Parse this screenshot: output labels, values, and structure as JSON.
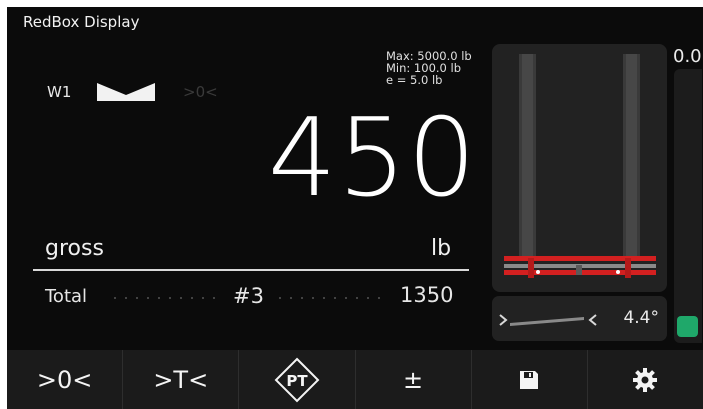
{
  "app": {
    "title": "RedBox Display"
  },
  "scale": {
    "channel": "W1",
    "zero_indicator": ">0<",
    "limits": {
      "max": "Max: 5000.0 lb",
      "min": "Min: 100.0 lb",
      "e": "e =  5.0  lb"
    },
    "weight": "450",
    "mode": "gross",
    "unit": "lb"
  },
  "total": {
    "label": "Total",
    "count": "#3",
    "value": "1350"
  },
  "tilt": {
    "angle": "4.4°"
  },
  "side": {
    "value": "0.0"
  },
  "toolbar": {
    "zero": ">0<",
    "tare": ">T<",
    "pt_label": "PT",
    "plus_minus": "±"
  },
  "icons": [
    "stable-icon",
    "forklift-icon",
    "tilt-icon",
    "save-icon",
    "settings-icon"
  ],
  "colors": {
    "background": "#0b0b0b",
    "panel": "#222222",
    "accent_red": "#d32020",
    "status_green": "#1fa86a"
  }
}
